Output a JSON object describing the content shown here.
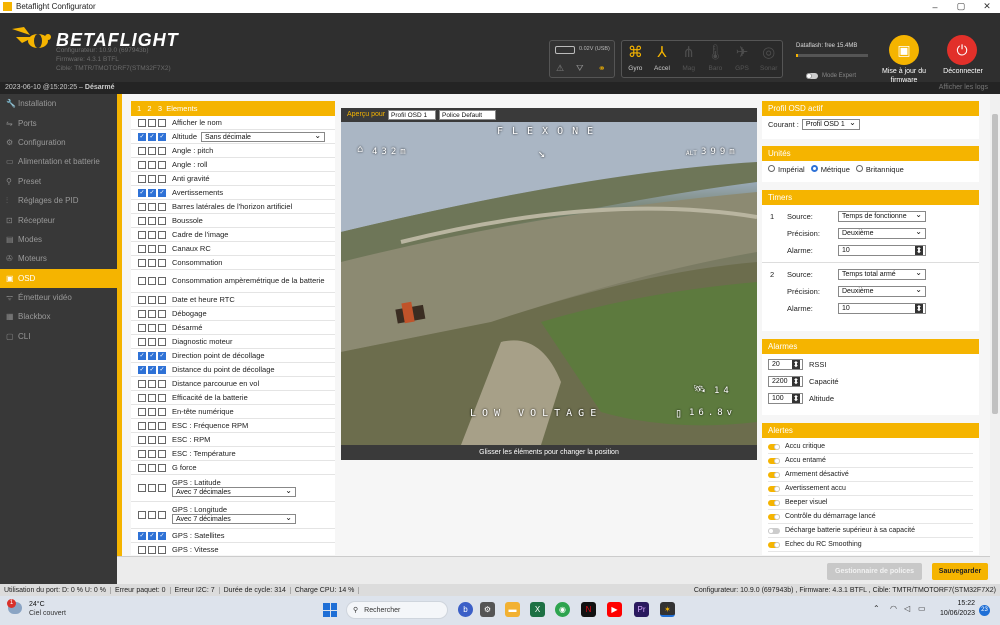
{
  "window": {
    "title": "Betaflight Configurator",
    "minimize": "–",
    "maximize": "▢",
    "close": "✕"
  },
  "header": {
    "brand": "BETAFLIGHT",
    "configurator": "Configurateur: 10.9.0 (697943b)",
    "firmware": "Firmware: 4.3.1 BTFL",
    "target": "Cible: TMTR/TMOTORF7(STM32F7X2)",
    "power": {
      "voltage": "0.02V (USB)"
    },
    "sensors": [
      {
        "label": "Gyro",
        "icon": "gyro-icon",
        "on": true
      },
      {
        "label": "Accel",
        "icon": "accel-icon",
        "on": true
      },
      {
        "label": "Mag",
        "icon": "mag-icon",
        "on": false
      },
      {
        "label": "Baro",
        "icon": "baro-icon",
        "on": false
      },
      {
        "label": "GPS",
        "icon": "gps-icon",
        "on": false
      },
      {
        "label": "Sonar",
        "icon": "sonar-icon",
        "on": false
      }
    ],
    "dataflash": "Dataflash: free 15.4MB",
    "dataflash_used": 0.03,
    "expert_mode": "Mode Expert",
    "update_firmware": "Mise à jour du firmware",
    "disconnect": "Déconnecter"
  },
  "status": {
    "left_date": "2023-06-10 @15:20:25 –",
    "left_state": "Désarmé",
    "show_logs": "Afficher les logs"
  },
  "sidebar": [
    {
      "label": "Installation",
      "icon": "wrench-icon"
    },
    {
      "label": "Ports",
      "icon": "ports-icon"
    },
    {
      "label": "Configuration",
      "icon": "gear-icon"
    },
    {
      "label": "Alimentation et batterie",
      "icon": "battery-icon"
    },
    {
      "label": "Preset",
      "icon": "preset-icon"
    },
    {
      "label": "Réglages de PID",
      "icon": "pid-icon"
    },
    {
      "label": "Récepteur",
      "icon": "receiver-icon"
    },
    {
      "label": "Modes",
      "icon": "modes-icon"
    },
    {
      "label": "Moteurs",
      "icon": "motors-icon"
    },
    {
      "label": "OSD",
      "icon": "osd-icon",
      "active": true
    },
    {
      "label": "Émetteur vidéo",
      "icon": "vtx-icon"
    },
    {
      "label": "Blackbox",
      "icon": "blackbox-icon"
    },
    {
      "label": "CLI",
      "icon": "cli-icon"
    }
  ],
  "elements": {
    "header_cols": "1   2   3",
    "header_label": "Elements",
    "items": [
      {
        "label": "Afficher le nom",
        "c": [
          0,
          0,
          0
        ]
      },
      {
        "label": "Altitude",
        "c": [
          1,
          1,
          1
        ],
        "select": "Sans décimale"
      },
      {
        "label": "Angle : pitch",
        "c": [
          0,
          0,
          0
        ]
      },
      {
        "label": "Angle : roll",
        "c": [
          0,
          0,
          0
        ]
      },
      {
        "label": "Anti gravité",
        "c": [
          0,
          0,
          0
        ]
      },
      {
        "label": "Avertissements",
        "c": [
          1,
          1,
          1
        ]
      },
      {
        "label": "Barres latérales de l'horizon artificiel",
        "c": [
          0,
          0,
          0
        ]
      },
      {
        "label": "Boussole",
        "c": [
          0,
          0,
          0
        ]
      },
      {
        "label": "Cadre de l'image",
        "c": [
          0,
          0,
          0
        ]
      },
      {
        "label": "Canaux RC",
        "c": [
          0,
          0,
          0
        ]
      },
      {
        "label": "Consommation",
        "c": [
          0,
          0,
          0
        ]
      },
      {
        "label": "Consommation ampèremétrique de la batterie",
        "c": [
          0,
          0,
          0
        ],
        "two": true
      },
      {
        "label": "Date et heure RTC",
        "c": [
          0,
          0,
          0
        ]
      },
      {
        "label": "Débogage",
        "c": [
          0,
          0,
          0
        ]
      },
      {
        "label": "Désarmé",
        "c": [
          0,
          0,
          0
        ]
      },
      {
        "label": "Diagnostic moteur",
        "c": [
          0,
          0,
          0
        ]
      },
      {
        "label": "Direction point de décollage",
        "c": [
          1,
          1,
          1
        ]
      },
      {
        "label": "Distance du point de décollage",
        "c": [
          1,
          1,
          1
        ]
      },
      {
        "label": "Distance parcourue en vol",
        "c": [
          0,
          0,
          0
        ]
      },
      {
        "label": "Efficacité de la batterie",
        "c": [
          0,
          0,
          0
        ]
      },
      {
        "label": "En-tête numérique",
        "c": [
          0,
          0,
          0
        ]
      },
      {
        "label": "ESC : Fréquence RPM",
        "c": [
          0,
          0,
          0
        ]
      },
      {
        "label": "ESC : RPM",
        "c": [
          0,
          0,
          0
        ]
      },
      {
        "label": "ESC : Température",
        "c": [
          0,
          0,
          0
        ]
      },
      {
        "label": "G force",
        "c": [
          0,
          0,
          0
        ]
      },
      {
        "label": "GPS : Latitude",
        "c": [
          0,
          0,
          0
        ],
        "dd": "Avec 7 décimales"
      },
      {
        "label": "GPS : Longitude",
        "c": [
          0,
          0,
          0
        ],
        "dd": "Avec 7 décimales"
      },
      {
        "label": "GPS : Satellites",
        "c": [
          1,
          1,
          1
        ]
      },
      {
        "label": "GPS : Vitesse",
        "c": [
          0,
          0,
          0
        ]
      }
    ]
  },
  "preview": {
    "label": "Aperçu pour",
    "profile": "Profil OSD 1",
    "font": "Police Default",
    "caption": "Glisser les éléments pour changer la position",
    "osd": {
      "craft": "FLEXONE",
      "home_dist": "432m",
      "alt_label": "ALT",
      "altitude": "399m",
      "sats": "14",
      "warning": "LOW VOLTAGE",
      "voltage": "16.8v"
    }
  },
  "right": {
    "profile": {
      "title": "Profil OSD actif",
      "current_label": "Courant :",
      "current": "Profil OSD 1"
    },
    "units": {
      "title": "Unités",
      "options": [
        "Impérial",
        "Métrique",
        "Britannique"
      ],
      "selected": 1
    },
    "timers": {
      "title": "Timers",
      "source_label": "Source:",
      "precision_label": "Précision:",
      "alarm_label": "Alarme:",
      "list": [
        {
          "n": "1",
          "source": "Temps de fonctionne",
          "precision": "Deuxième",
          "alarm": "10"
        },
        {
          "n": "2",
          "source": "Temps total armé",
          "precision": "Deuxième",
          "alarm": "10"
        }
      ]
    },
    "alarms": {
      "title": "Alarmes",
      "list": [
        {
          "value": "20",
          "label": "RSSI"
        },
        {
          "value": "2200",
          "label": "Capacité"
        },
        {
          "value": "100",
          "label": "Altitude"
        }
      ]
    },
    "alerts": {
      "title": "Alertes",
      "list": [
        {
          "label": "Accu critique",
          "on": true
        },
        {
          "label": "Accu entamé",
          "on": true
        },
        {
          "label": "Armement désactivé",
          "on": true
        },
        {
          "label": "Avertissement accu",
          "on": true
        },
        {
          "label": "Beeper visuel",
          "on": true
        },
        {
          "label": "Contrôle du démarrage lancé",
          "on": true
        },
        {
          "label": "Décharge batterie supérieur à sa capacité",
          "on": false
        },
        {
          "label": "Echec du RC Smoothing",
          "on": true
        }
      ]
    }
  },
  "buttons": {
    "font_manager": "Gestionnaire de polices",
    "save": "Sauvegarder"
  },
  "stats": [
    "Utilisation du port: D: 0 % U: 0 %",
    "Erreur paquet: 0",
    "Erreur I2C: 7",
    "Durée de cycle: 314",
    "Charge CPU: 14 %"
  ],
  "stats_right": "Configurateur: 10.9.0 (697943b) , Firmware: 4.3.1 BTFL , Cible: TMTR/TMOTORF7(STM32F7X2)",
  "taskbar": {
    "temp": "24°C",
    "weather": "Ciel couvert",
    "search": "Rechercher",
    "time": "15:22",
    "date": "10/06/2023",
    "badge": "1",
    "notif": "23"
  },
  "colors": {
    "accent": "#f5b400",
    "checkbox": "#2f72d6"
  }
}
